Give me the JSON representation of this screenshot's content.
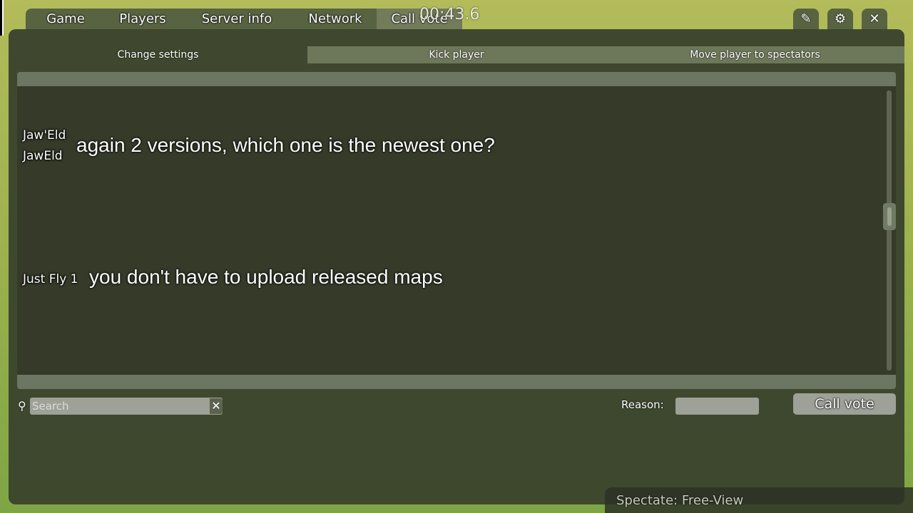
{
  "hud": {
    "timer": "00:43.6"
  },
  "tabs": [
    {
      "label": "Game"
    },
    {
      "label": "Players"
    },
    {
      "label": "Server info"
    },
    {
      "label": "Network"
    },
    {
      "label": "Call vote",
      "active": true
    }
  ],
  "window_controls": {
    "edit_icon": "✎",
    "settings_icon": "⚙",
    "close_icon": "✕"
  },
  "subtabs": [
    {
      "label": "Change settings",
      "active": true
    },
    {
      "label": "Kick player"
    },
    {
      "label": "Move player to spectators"
    }
  ],
  "chat": [
    {
      "names": [
        "Jaw'Eld",
        "JawEld"
      ],
      "text": "again 2 versions, which one is the newest one?"
    },
    {
      "names": [
        "Just Fly 1"
      ],
      "text": "you don't have to upload released maps"
    }
  ],
  "search": {
    "placeholder": "Search",
    "value": "",
    "clear_icon": "✕",
    "icon": "⚲"
  },
  "reason": {
    "label": "Reason:",
    "value": ""
  },
  "call_vote_button": {
    "label": "Call vote"
  },
  "spectate": {
    "text": "Spectate: Free-View"
  },
  "colors": {
    "panel": "#3a442d",
    "list_body": "#353a29",
    "input": "#9da197",
    "active_tab": "#747c5c"
  }
}
